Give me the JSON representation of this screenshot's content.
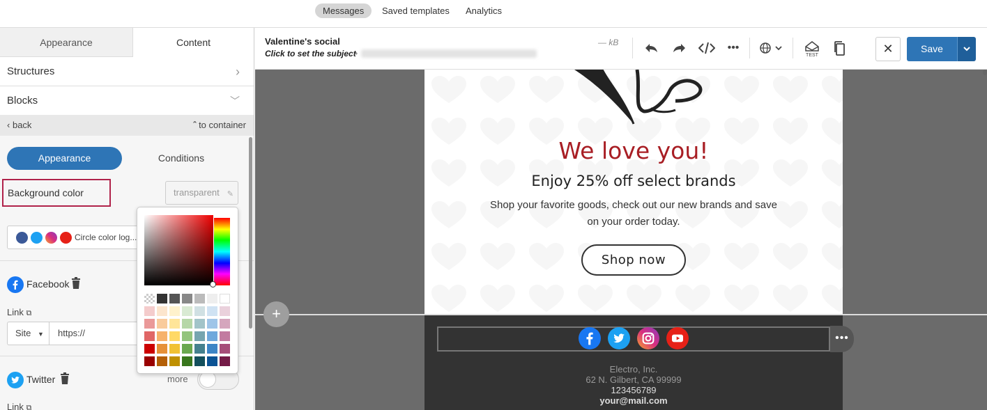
{
  "top_nav": {
    "messages": "Messages",
    "saved_templates": "Saved templates",
    "analytics": "Analytics"
  },
  "left_panel": {
    "tab_appearance": "Appearance",
    "tab_content": "Content",
    "structures": "Structures",
    "blocks": "Blocks",
    "back": "back",
    "to_container": "to container",
    "seg_appearance": "Appearance",
    "seg_conditions": "Conditions",
    "background_color_label": "Background color",
    "background_color_value": "transparent",
    "social_style": "Circle color log...",
    "facebook_label": "Facebook",
    "link_label": "Link",
    "site_select": "Site",
    "url_value": "https://",
    "twitter_label": "Twitter",
    "more_label": "more",
    "link_label_2": "Link"
  },
  "toolbar": {
    "title": "Valentine's social",
    "subject": "Click to set the subject",
    "size": "— kB",
    "save": "Save"
  },
  "email": {
    "headline": "We love you!",
    "subhead": "Enjoy 25% off select brands",
    "body": "Shop your favorite goods, check out our new brands and save on your order today.",
    "cta": "Shop now",
    "company": "Electro, Inc.",
    "address": "62 N. Gilbert, CA 99999",
    "phone": "123456789",
    "email": "your@mail.com"
  },
  "colors": {
    "accent": "#2e75b6",
    "headline": "#a81e24",
    "highlight_border": "#b0224a",
    "facebook": "#1877f2",
    "twitter": "#1da1f2",
    "youtube": "#e62117"
  },
  "palette": [
    [
      "checker",
      "#333333",
      "#555555",
      "#888888",
      "#bbbbbb",
      "#eeeeee",
      "#ffffff"
    ],
    [
      "#f4cccc",
      "#fce5cd",
      "#fff2cc",
      "#d9ead3",
      "#d0e0e3",
      "#cfe2f3",
      "#ead1dc"
    ],
    [
      "#ea9999",
      "#f9cb9c",
      "#ffe599",
      "#b6d7a8",
      "#a2c4c9",
      "#9fc5e8",
      "#d5a6bd"
    ],
    [
      "#e06666",
      "#f6b26b",
      "#ffd966",
      "#93c47d",
      "#76a5af",
      "#6fa8dc",
      "#c27ba0"
    ],
    [
      "#cc0000",
      "#e69138",
      "#f1c232",
      "#6aa84f",
      "#45818e",
      "#3d85c6",
      "#a64d79"
    ],
    [
      "#990000",
      "#b45f06",
      "#bf9000",
      "#38761d",
      "#134f5c",
      "#0b5394",
      "#741b47"
    ]
  ]
}
